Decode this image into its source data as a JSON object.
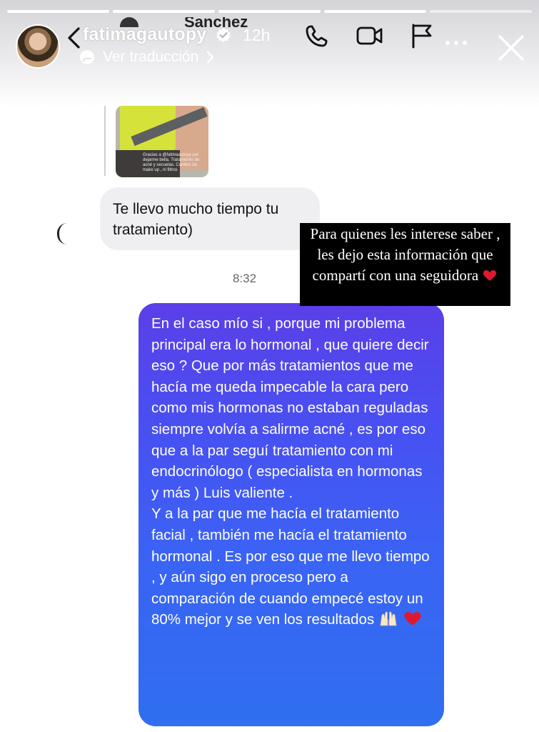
{
  "story": {
    "username": "fatimagautopy",
    "time": "12h",
    "translate_label": "Ver traducción",
    "progress_segments": [
      true,
      true,
      true,
      true,
      false
    ],
    "partial_dm_name": "Sanchez"
  },
  "chat": {
    "incoming_message": "Te llevo mucho tiempo tu tratamiento)",
    "timestamp": "8:32",
    "outgoing_paragraphs": [
      "En el caso mío si , porque mi problema principal era lo hormonal , que quiere decir eso ? Que por más tratamientos que me hacía me queda impecable la cara pero como mis hormonas no estaban reguladas siempre volvía a salirme acné , es por eso que a la par seguí tratamiento con mi endocrinólogo ( especialista en hormonas y más ) Luis valiente .",
      "Y a la par que me hacía el tratamiento facial , también me hacía el tratamiento hormonal . Es por eso que me llevo tiempo , y aún sigo en proceso pero a comparación de cuando empecé estoy un 80% mejor y se ven los resultados"
    ],
    "shared_image_caption": "Gracias a @fatimaautopy por dejarme bella. Tratamiento de acné y secuelas. Cambio sin make up , ni filtros"
  },
  "overlay": {
    "text": "Para quienes les interese saber , les dejo esta información que compartí con una seguidora"
  },
  "colors": {
    "bubble_top": "#5a3fe8",
    "bubble_bottom": "#2f6ff0",
    "incoming_bubble": "#efeff2",
    "overlay_bg": "#000000",
    "heart": "#e0182d"
  },
  "icons": [
    "back-icon",
    "verified-icon",
    "phone-icon",
    "video-icon",
    "flag-icon",
    "more-icon",
    "close-icon",
    "translate-icon",
    "chevron-right-icon",
    "heart-icon",
    "raised-hands-icon"
  ]
}
